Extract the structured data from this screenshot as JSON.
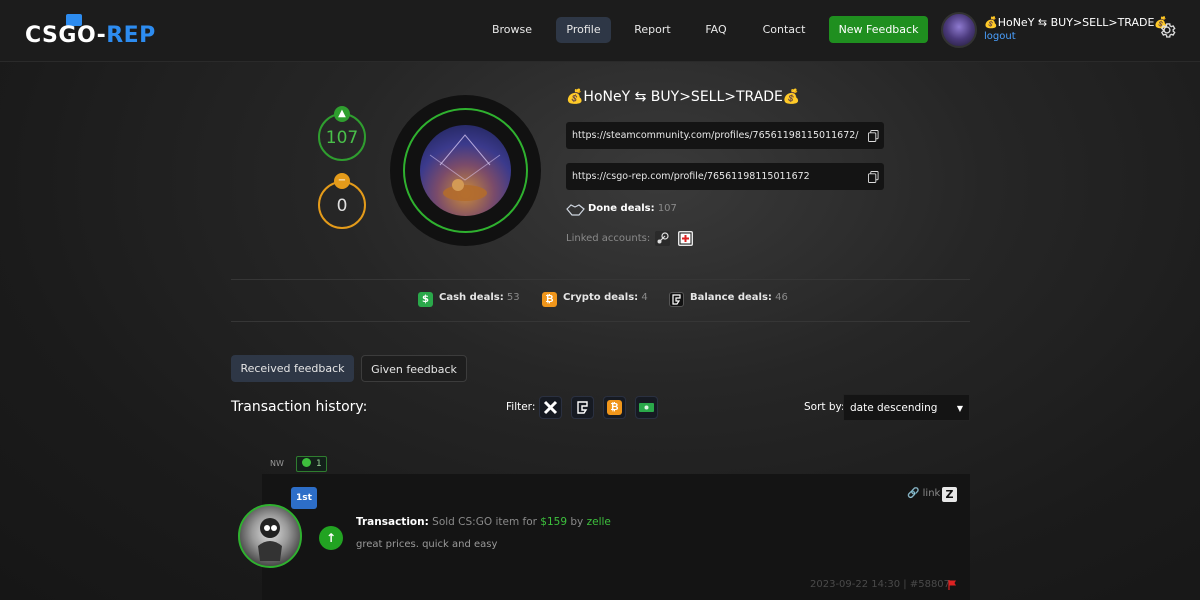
{
  "header": {
    "logo_left": "CSGO-",
    "logo_right": "REP",
    "nav": [
      "Browse",
      "Profile",
      "Report",
      "FAQ",
      "Contact"
    ],
    "active_nav": "Profile",
    "new_feedback": "New Feedback",
    "user_name": "💰HoNeY ⇆ BUY>SELL>TRADE💰",
    "logout": "logout"
  },
  "profile": {
    "positive_count": "107",
    "neutral_count": "0",
    "name": "💰HoNeY ⇆ BUY>SELL>TRADE💰",
    "steam_url": "https://steamcommunity.com/profiles/76561198115011672/",
    "rep_url": "https://csgo-rep.com/profile/76561198115011672",
    "done_deals_label": "Done deals:",
    "done_deals_value": "107",
    "linked_label": "Linked accounts:"
  },
  "deals": {
    "cash_label": "Cash deals:",
    "cash_value": "53",
    "crypto_label": "Crypto deals:",
    "crypto_value": "4",
    "balance_label": "Balance deals:",
    "balance_value": "46"
  },
  "tabs": {
    "received": "Received feedback",
    "given": "Given feedback"
  },
  "history": {
    "title": "Transaction history:",
    "filter_label": "Filter:",
    "sort_label": "Sort by:",
    "sort_value": "date descending"
  },
  "feedback": {
    "group": "NW",
    "group_count": "1",
    "badge": "1st",
    "transaction_label": "Transaction:",
    "transaction_text_1": "Sold CS:GO item for",
    "amount": "$159",
    "transaction_text_2": "by",
    "method": "zelle",
    "comment": "great prices. quick and easy",
    "link_label": "link",
    "meta": "2023-09-22 14:30 | #58807"
  },
  "colors": {
    "accent_green": "#1f8f1f",
    "positive": "#2f9e2f",
    "neutral": "#e49b1a",
    "link_blue": "#4aa0ff",
    "active_tab": "#2e3746"
  }
}
